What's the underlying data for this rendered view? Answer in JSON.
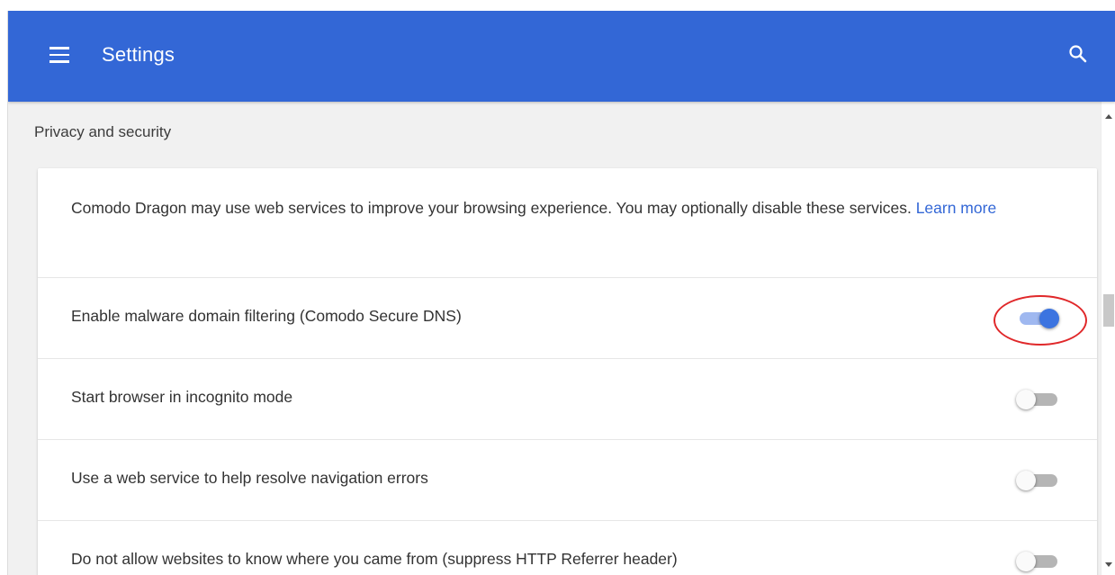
{
  "header": {
    "title": "Settings",
    "menu_icon": "hamburger-menu-icon",
    "search_icon": "search-icon",
    "background_color": "#3367d6"
  },
  "section": {
    "title": "Privacy and security",
    "description": "Comodo Dragon may use web services to improve your browsing experience. You may optionally disable these services.",
    "learn_more": "Learn more",
    "link_color": "#3367d6"
  },
  "settings": [
    {
      "label": "Enable malware domain filtering (Comodo Secure DNS)",
      "enabled": true
    },
    {
      "label": "Start browser in incognito mode",
      "enabled": false
    },
    {
      "label": "Use a web service to help resolve navigation errors",
      "enabled": false
    },
    {
      "label": "Do not allow websites to know where you came from (suppress HTTP Referrer header)",
      "enabled": false
    }
  ],
  "annotation_color": "#e0282a"
}
